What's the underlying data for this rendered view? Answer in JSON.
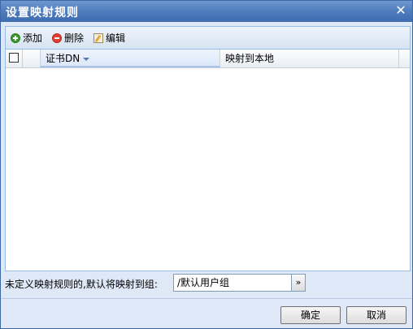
{
  "dialog": {
    "title": "设置映射规则",
    "close_symbol": "✕"
  },
  "toolbar": {
    "add_label": "添加",
    "delete_label": "删除",
    "edit_label": "编辑"
  },
  "grid": {
    "columns": [
      "证书DN",
      "映射到本地"
    ],
    "rows": []
  },
  "default_mapping": {
    "label": "未定义映射规则的,默认将映射到组:",
    "value": "/默认用户组",
    "picker_symbol": "»"
  },
  "buttons": {
    "ok": "确定",
    "cancel": "取消"
  }
}
